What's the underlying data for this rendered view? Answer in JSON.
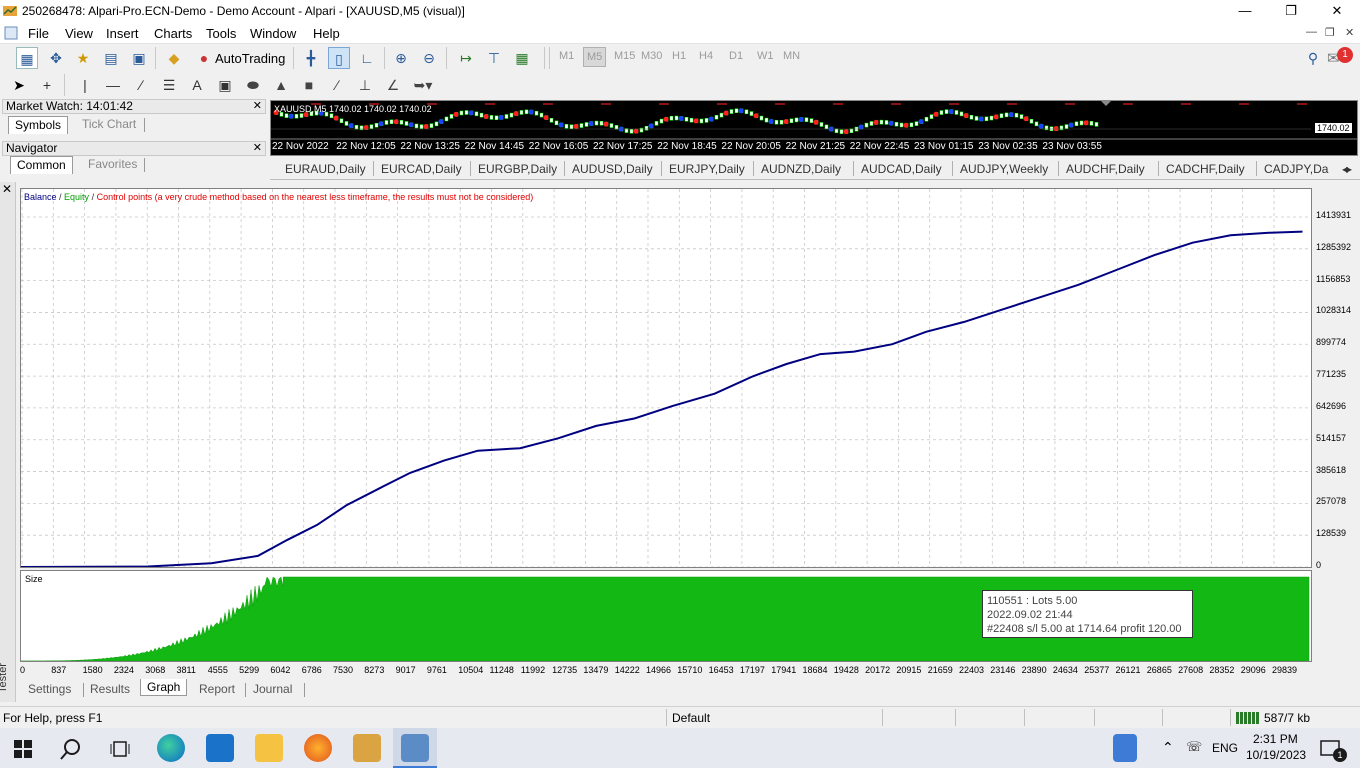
{
  "window": {
    "title": "250268478: Alpari-Pro.ECN-Demo - Demo Account - Alpari - [XAUUSD,M5 (visual)]"
  },
  "menu": [
    "File",
    "View",
    "Insert",
    "Charts",
    "Tools",
    "Window",
    "Help"
  ],
  "toolbar": {
    "autotrading_label": "AutoTrading",
    "timeframes": [
      "M1",
      "M5",
      "M15",
      "M30",
      "H1",
      "H4",
      "D1",
      "W1",
      "MN"
    ],
    "notification_count": "1"
  },
  "market_watch": {
    "title": "Market Watch: 14:01:42",
    "tabs": [
      "Symbols",
      "Tick Chart"
    ]
  },
  "navigator": {
    "title": "Navigator",
    "tabs": [
      "Common",
      "Favorites"
    ]
  },
  "mini_chart": {
    "symbol_text": "XAUUSD,M5  1740.02  1740.02  1740.02",
    "price": "1740.02",
    "time_labels": [
      "22 Nov 2022",
      "22 Nov 12:05",
      "22 Nov 13:25",
      "22 Nov 14:45",
      "22 Nov 16:05",
      "22 Nov 17:25",
      "22 Nov 18:45",
      "22 Nov 20:05",
      "22 Nov 21:25",
      "22 Nov 22:45",
      "23 Nov 01:15",
      "23 Nov 02:35",
      "23 Nov 03:55"
    ]
  },
  "chart_tabs": [
    "EURAUD,Daily",
    "EURCAD,Daily",
    "EURGBP,Daily",
    "AUDUSD,Daily",
    "EURJPY,Daily",
    "AUDNZD,Daily",
    "AUDCAD,Daily",
    "AUDJPY,Weekly",
    "AUDCHF,Daily",
    "CADCHF,Daily",
    "CADJPY,Da"
  ],
  "tester": {
    "side_label": "Tester",
    "legend": {
      "balance": "Balance",
      "equity": "Equity",
      "control": "Control points (a very crude method based on the nearest less timeframe, the results must not be considered)"
    },
    "size_label": "Size",
    "tabs": [
      "Settings",
      "Results",
      "Graph",
      "Report",
      "Journal"
    ],
    "active_tab": "Graph",
    "tooltip": {
      "line1": "110551 : Lots 5.00",
      "line2": "2022.09.02 21:44",
      "line3": "#22408 s/l 5.00 at 1714.64 profit 120.00"
    },
    "colors": {
      "balance": "#000080",
      "equity": "#008000",
      "size_fill": "#14b814"
    }
  },
  "chart_data": {
    "type": "line",
    "title": "",
    "xlabel": "",
    "ylabel": "",
    "y_ticks": [
      "1413931",
      "1285392",
      "1156853",
      "1028314",
      "899774",
      "771235",
      "642696",
      "514157",
      "385618",
      "257078",
      "128539",
      "0"
    ],
    "x_ticks": [
      "0",
      "837",
      "1580",
      "2324",
      "3068",
      "3811",
      "4555",
      "5299",
      "6042",
      "6786",
      "7530",
      "8273",
      "9017",
      "9761",
      "10504",
      "11248",
      "11992",
      "12735",
      "13479",
      "14222",
      "14966",
      "15710",
      "16453",
      "17197",
      "17941",
      "18684",
      "19428",
      "20172",
      "20915",
      "21659",
      "22403",
      "23146",
      "23890",
      "24634",
      "25377",
      "26121",
      "26865",
      "27608",
      "28352",
      "29096",
      "29839"
    ],
    "ylim": [
      0,
      1413931
    ],
    "xlim": [
      0,
      30500
    ],
    "series": [
      {
        "name": "Balance",
        "x": [
          0,
          3000,
          4500,
          5600,
          6300,
          7000,
          7700,
          8500,
          9200,
          10000,
          10800,
          11800,
          12700,
          13600,
          14500,
          15400,
          16400,
          17300,
          18100,
          18900,
          19700,
          20600,
          21400,
          22300,
          23200,
          24100,
          25000,
          25900,
          26800,
          27700,
          28600,
          29500,
          30300
        ],
        "y": [
          0,
          2000,
          15000,
          45000,
          110000,
          170000,
          250000,
          320000,
          380000,
          430000,
          470000,
          480000,
          520000,
          570000,
          600000,
          650000,
          700000,
          770000,
          820000,
          860000,
          870000,
          900000,
          950000,
          990000,
          1040000,
          1090000,
          1140000,
          1200000,
          1260000,
          1310000,
          1340000,
          1350000,
          1355000
        ]
      }
    ],
    "size_series": {
      "name": "Size",
      "full_from_x": 6200,
      "value": "5.00"
    }
  },
  "statusbar": {
    "help": "For Help, press F1",
    "profile": "Default",
    "traffic": "587/7 kb"
  },
  "taskbar": {
    "time": "2:31 PM",
    "date": "10/19/2023",
    "lang": "ENG",
    "notif": "1"
  }
}
